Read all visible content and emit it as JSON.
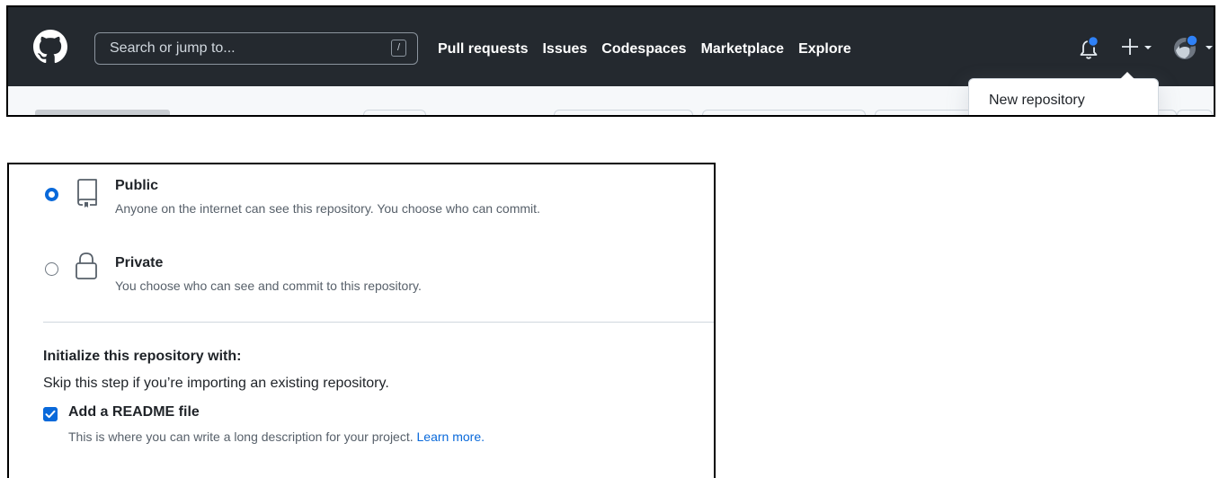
{
  "header": {
    "search": {
      "placeholder": "Search or jump to...",
      "shortcut": "/"
    },
    "nav": [
      "Pull requests",
      "Issues",
      "Codespaces",
      "Marketplace",
      "Explore"
    ],
    "icons": [
      "github-logo-icon",
      "bell-icon",
      "plus-icon",
      "caret-down-icon",
      "avatar"
    ],
    "notification_dot_color": "#2f81f7",
    "background_color": "#24292f"
  },
  "dropdown": {
    "items": [
      "New repository"
    ]
  },
  "visibility": {
    "options": [
      {
        "title": "Public",
        "description": "Anyone on the internet can see this repository. You choose who can commit.",
        "selected": true,
        "icon": "repo-icon"
      },
      {
        "title": "Private",
        "description": "You choose who can see and commit to this repository.",
        "selected": false,
        "icon": "lock-icon"
      }
    ]
  },
  "initialize": {
    "heading": "Initialize this repository with:",
    "subtext": "Skip this step if you’re importing an existing repository.",
    "readme": {
      "label": "Add a README file",
      "checked": true,
      "description": "This is where you can write a long description for your project.",
      "link": "Learn more."
    }
  },
  "colors": {
    "accent": "#0969da",
    "muted_text": "#57606a",
    "border": "#d0d7de"
  }
}
